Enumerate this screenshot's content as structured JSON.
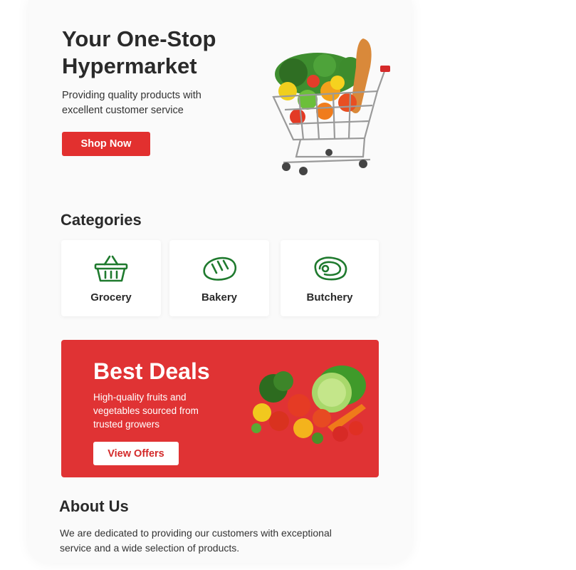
{
  "hero": {
    "title": "Your One-Stop Hypermarket",
    "subtitle": "Providing quality products with excellent customer service",
    "cta_label": "Shop Now"
  },
  "categories": {
    "title": "Categories",
    "items": [
      {
        "label": "Grocery",
        "icon": "basket-icon"
      },
      {
        "label": "Bakery",
        "icon": "bread-icon"
      },
      {
        "label": "Butchery",
        "icon": "meat-icon"
      }
    ]
  },
  "deals": {
    "title": "Best Deals",
    "description": "High-quality fruits and vegetables sourced from trusted growers",
    "cta_label": "View Offers"
  },
  "about": {
    "title": "About Us",
    "text": "We are dedicated to providing our customers with exceptional service and a wide selection of products."
  },
  "colors": {
    "accent": "#e2302f",
    "icon_green": "#1f7a2e",
    "background": "#fafafa"
  }
}
